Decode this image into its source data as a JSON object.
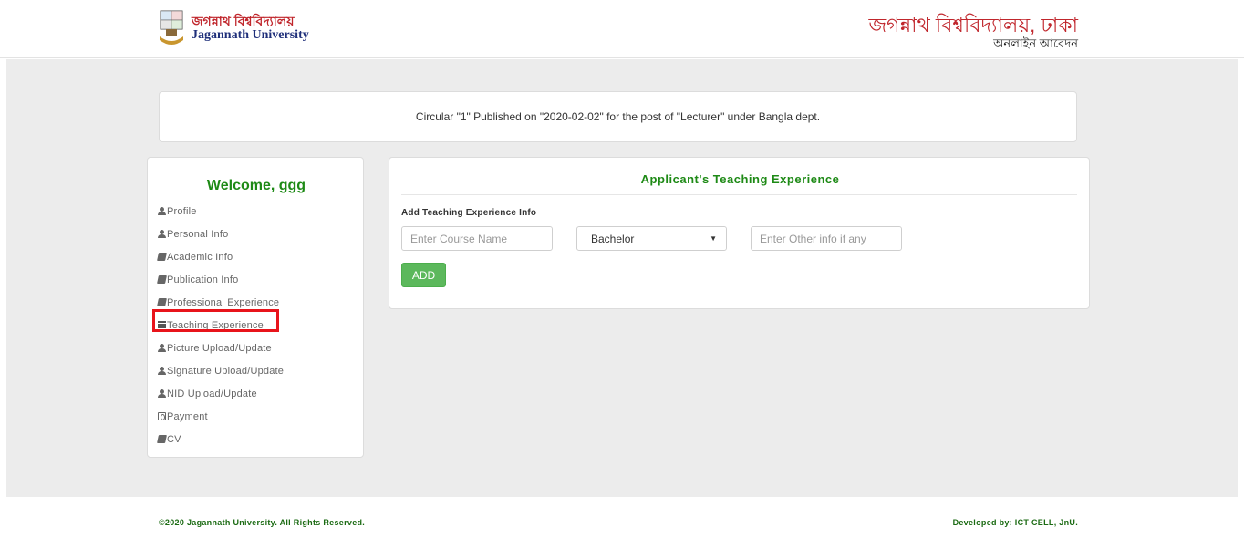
{
  "header": {
    "logo_bn": "জগন্নাথ বিশ্ববিদ্যালয়",
    "logo_en": "Jagannath University",
    "title": "জগন্নাথ বিশ্ববিদ্যালয়, ঢাকা",
    "subtitle": "অনলাইন আবেদন"
  },
  "circular": {
    "text": "Circular \"1\" Published on \"2020-02-02\" for the post of \"Lecturer\" under Bangla dept."
  },
  "sidebar": {
    "welcome": "Welcome, ggg",
    "items": [
      {
        "label": "Profile",
        "icon": "user-icon"
      },
      {
        "label": "Personal Info",
        "icon": "user-icon"
      },
      {
        "label": "Academic Info",
        "icon": "book-icon"
      },
      {
        "label": "Publication Info",
        "icon": "book-icon"
      },
      {
        "label": "Professional Experience",
        "icon": "book-icon"
      },
      {
        "label": "Teaching Experience",
        "icon": "list-icon",
        "active": true
      },
      {
        "label": "Picture Upload/Update",
        "icon": "user-icon"
      },
      {
        "label": "Signature Upload/Update",
        "icon": "user-icon"
      },
      {
        "label": "NID Upload/Update",
        "icon": "user-icon"
      },
      {
        "label": "Payment",
        "icon": "money-icon"
      },
      {
        "label": "CV",
        "icon": "book-icon"
      }
    ]
  },
  "panel": {
    "title": "Applicant's Teaching Experience",
    "section_label": "Add Teaching Experience Info",
    "course_placeholder": "Enter Course Name",
    "degree_selected": "Bachelor",
    "other_placeholder": "Enter Other info if any",
    "add_label": "ADD"
  },
  "footer": {
    "copyright": "©2020 Jagannath University. All Rights Reserved.",
    "developer": "Developed by: ICT CELL, JnU."
  },
  "colors": {
    "accent_green": "#1e8a16",
    "button_green": "#5cb85c",
    "highlight_red": "#e8141b",
    "title_red": "#c0262c"
  }
}
